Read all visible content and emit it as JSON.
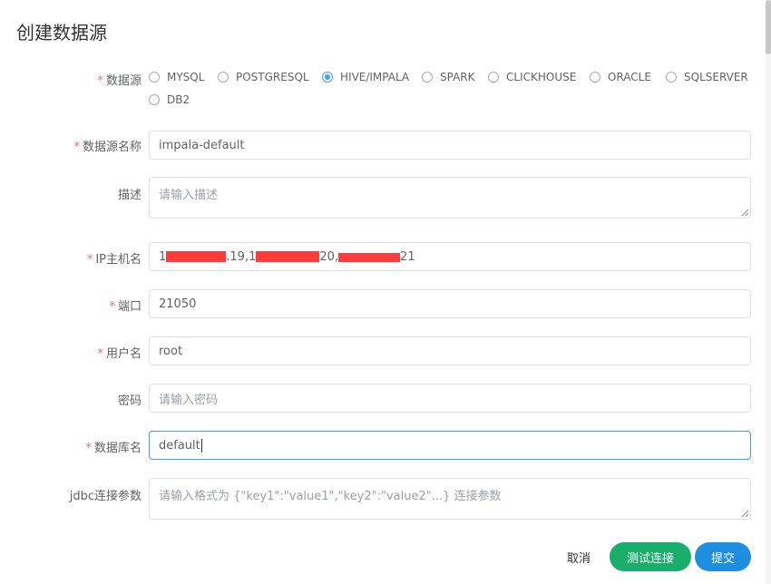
{
  "dialog": {
    "title": "创建数据源"
  },
  "form": {
    "datasource": {
      "label": "数据源",
      "options": [
        "MYSQL",
        "POSTGRESQL",
        "HIVE/IMPALA",
        "SPARK",
        "CLICKHOUSE",
        "ORACLE",
        "SQLSERVER",
        "DB2"
      ],
      "selected": "HIVE/IMPALA"
    },
    "name": {
      "label": "数据源名称",
      "value": "impala-default"
    },
    "description": {
      "label": "描述",
      "placeholder": "请输入描述"
    },
    "host": {
      "label": "IP主机名",
      "parts": [
        "1",
        ".19,1",
        "20,",
        "21"
      ]
    },
    "port": {
      "label": "端口",
      "value": "21050"
    },
    "username": {
      "label": "用户名",
      "value": "root"
    },
    "password": {
      "label": "密码",
      "placeholder": "请输入密码"
    },
    "database": {
      "label": "数据库名",
      "value": "default"
    },
    "jdbc_params": {
      "label": "jdbc连接参数",
      "placeholder": "请输入格式为 {\"key1\":\"value1\",\"key2\":\"value2\"...} 连接参数"
    }
  },
  "buttons": {
    "cancel": "取消",
    "test": "测试连接",
    "submit": "提交"
  },
  "colors": {
    "primary": "#409eff",
    "success": "#1aae6c",
    "submit": "#1e8fe0",
    "required": "#f56c6c",
    "redact": "#ff3b3b"
  }
}
